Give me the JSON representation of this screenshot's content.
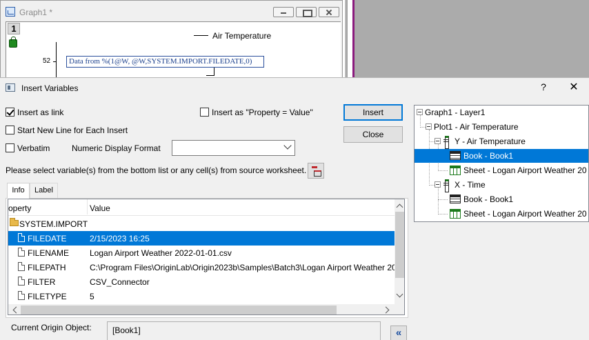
{
  "graph_window": {
    "title": "Graph1 *",
    "layer_number": "1",
    "legend_label": "Air Temperature",
    "axis_tick_label": "52",
    "text_object": "Data from %(1@W, @W,SYSTEM.IMPORT.FILEDATE,0)"
  },
  "dialog": {
    "title": "Insert Variables",
    "help_glyph": "?",
    "close_glyph": "✕",
    "options": {
      "insert_as_link": {
        "label": "Insert as link",
        "checked": true
      },
      "start_new_line": {
        "label": "Start New Line for Each Insert",
        "checked": false
      },
      "verbatim": {
        "label": "Verbatim",
        "checked": false
      },
      "property_value": {
        "label": "Insert as \"Property = Value\"",
        "checked": false
      }
    },
    "numeric_format": {
      "label": "Numeric Display Format",
      "value": ""
    },
    "buttons": {
      "insert": "Insert",
      "close": "Close"
    },
    "instruction": "Please select variable(s) from the bottom list or any cell(s) from source worksheet.",
    "tabs": [
      {
        "label": "Info",
        "active": true
      },
      {
        "label": "Label",
        "active": false
      }
    ],
    "info_table": {
      "columns": {
        "property": "operty",
        "value": "Value"
      },
      "group": "SYSTEM.IMPORT",
      "rows": [
        {
          "name": "FILEDATE",
          "value": "2/15/2023 16:25",
          "selected": true
        },
        {
          "name": "FILENAME",
          "value": "Logan Airport Weather 2022-01-01.csv",
          "selected": false
        },
        {
          "name": "FILEPATH",
          "value": "C:\\Program Files\\OriginLab\\Origin2023b\\Samples\\Batch3\\Logan Airport Weather 20",
          "selected": false
        },
        {
          "name": "FILTER",
          "value": "CSV_Connector",
          "selected": false
        },
        {
          "name": "FILETYPE",
          "value": "5",
          "selected": false
        }
      ]
    },
    "tree": [
      {
        "label": "Graph1 - Layer1",
        "icon": "none",
        "selected": false
      },
      {
        "label": "Plot1 - Air Temperature",
        "icon": "none",
        "selected": false
      },
      {
        "label": "Y - Air Temperature",
        "icon": "column-icon",
        "selected": false
      },
      {
        "label": "Book - Book1",
        "icon": "book-icon",
        "selected": true
      },
      {
        "label": "Sheet - Logan Airport Weather 20",
        "icon": "sheet-icon",
        "selected": false
      },
      {
        "label": "X - Time",
        "icon": "column-icon",
        "selected": false
      },
      {
        "label": "Book - Book1",
        "icon": "book-icon",
        "selected": false
      },
      {
        "label": "Sheet - Logan Airport Weather 20",
        "icon": "sheet-icon",
        "selected": false
      }
    ],
    "current_object": {
      "label": "Current Origin Object:",
      "value": "[Book1]"
    },
    "collapse_glyph": "«"
  },
  "colors": {
    "selection": "#0078d7",
    "dialog_bg": "#f0f0f0",
    "workspace_bg": "#ababab",
    "taskbar_accent": "#8b1a7e",
    "text_object": "#1a3f8c"
  }
}
